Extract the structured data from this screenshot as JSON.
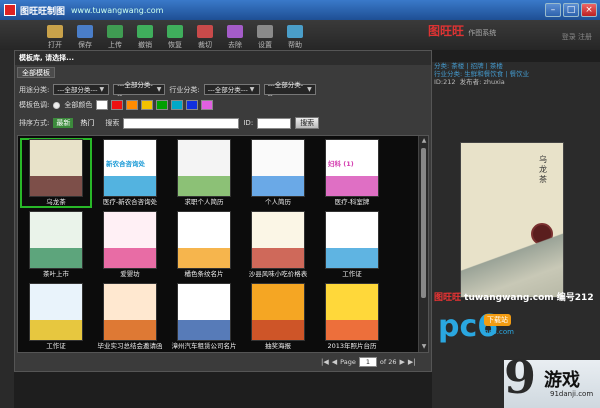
{
  "app": {
    "title": "图旺旺制图",
    "url": "www.tuwangwang.com",
    "brand": "图旺旺",
    "brand_sub": "作图系统",
    "top_right": "登录 注册"
  },
  "toolbar": [
    {
      "label": "打开",
      "icon": "folder-icon",
      "color": "#c9a24a"
    },
    {
      "label": "保存",
      "icon": "save-icon",
      "color": "#4a7ec9"
    },
    {
      "label": "上传",
      "icon": "upload-icon",
      "color": "#3f9c52"
    },
    {
      "label": "撤销",
      "icon": "undo-icon",
      "color": "#3fae5c"
    },
    {
      "label": "恢复",
      "icon": "redo-icon",
      "color": "#3fae5c"
    },
    {
      "label": "裁切",
      "icon": "crop-icon",
      "color": "#c94a4a"
    },
    {
      "label": "去除",
      "icon": "erase-icon",
      "color": "#a45cc9"
    },
    {
      "label": "设置",
      "icon": "gear-icon",
      "color": "#8a8a8a"
    },
    {
      "label": "帮助",
      "icon": "help-icon",
      "color": "#4a9ec9"
    }
  ],
  "dialog": {
    "title": "模板库, 请选择...",
    "tab": "全部模板",
    "filters": {
      "usage_label": "用途分类:",
      "usage_values": [
        "---全部分类---",
        "---全部分类---"
      ],
      "industry_label": "行业分类:",
      "industry_values": [
        "---全部分类---",
        "---全部分类---"
      ]
    },
    "color_label": "模板色调:",
    "color_all": "全部颜色",
    "colors": [
      "#ffffff",
      "#ee1111",
      "#ff8c00",
      "#f2c200",
      "#00a000",
      "#00a8c8",
      "#1030e0",
      "#e060e0"
    ],
    "sort_label": "排序方式:",
    "sort_latest": "最新",
    "sort_hot": "热门",
    "search_label": "搜索",
    "id_label": "ID:",
    "search_button": "搜索",
    "templates": [
      {
        "caption": "乌龙茶",
        "bg": "#e8e2c9",
        "accent": "#5a1e1e",
        "selected": true
      },
      {
        "caption": "医疗-新农合咨询处",
        "bg": "#ffffff",
        "accent": "#1a9ad6",
        "text": "新农合咨询处"
      },
      {
        "caption": "求职个人简历",
        "bg": "#f4f4f4",
        "accent": "#6ab04c"
      },
      {
        "caption": "个人简历",
        "bg": "#fafafa",
        "accent": "#3a8ee0"
      },
      {
        "caption": "医疗-科室牌",
        "bg": "#ffffff",
        "accent": "#d43fb0",
        "text": "妇科 (1)"
      },
      {
        "caption": "茶叶上市",
        "bg": "#eaf3ea",
        "accent": "#2e8b57"
      },
      {
        "caption": "爱婴坊",
        "bg": "#fff0f5",
        "accent": "#e0408a"
      },
      {
        "caption": "橘色条纹名片",
        "bg": "#ffffff",
        "accent": "#f39c12"
      },
      {
        "caption": "沙县风味小吃价格表",
        "bg": "#fbf6e6",
        "accent": "#c0392b"
      },
      {
        "caption": "工作证",
        "bg": "#ffffff",
        "accent": "#2a9bd8"
      },
      {
        "caption": "工作证",
        "bg": "#e9f3fb",
        "accent": "#e6b800"
      },
      {
        "caption": "毕业实习总结会邀请函",
        "bg": "#ffe8d0",
        "accent": "#d35400"
      },
      {
        "caption": "漳州汽车租赁公司名片",
        "bg": "#ffffff",
        "accent": "#1f4fa0"
      },
      {
        "caption": "抽奖海报",
        "bg": "#f5a623",
        "accent": "#c0392b"
      },
      {
        "caption": "2013年照片台历",
        "bg": "#ffd83a",
        "accent": "#e74c3c"
      }
    ],
    "pager": {
      "page_label": "Page",
      "current": "1",
      "of_label": "of 26"
    }
  },
  "info_panel": {
    "category_label": "分类:",
    "category": "茶楼 | 招牌 | 茶楼",
    "industry_label": "行业分类:",
    "industry": "生鲜和餐饮食 | 餐饮业",
    "id_label": "ID:212",
    "author_label": "发布者:",
    "author": "zhuxia",
    "preview_title": "乌龙茶"
  },
  "watermark": {
    "brand": "图旺旺",
    "site": "tuwangwang.com",
    "code": "编号212"
  },
  "overlay_logos": {
    "pc6": "pc6",
    "pc6_download": "下载站",
    "pc6_site": "pc6.com",
    "game_nine": "9",
    "game_text": "游戏",
    "game_domain": "91danji.com"
  }
}
